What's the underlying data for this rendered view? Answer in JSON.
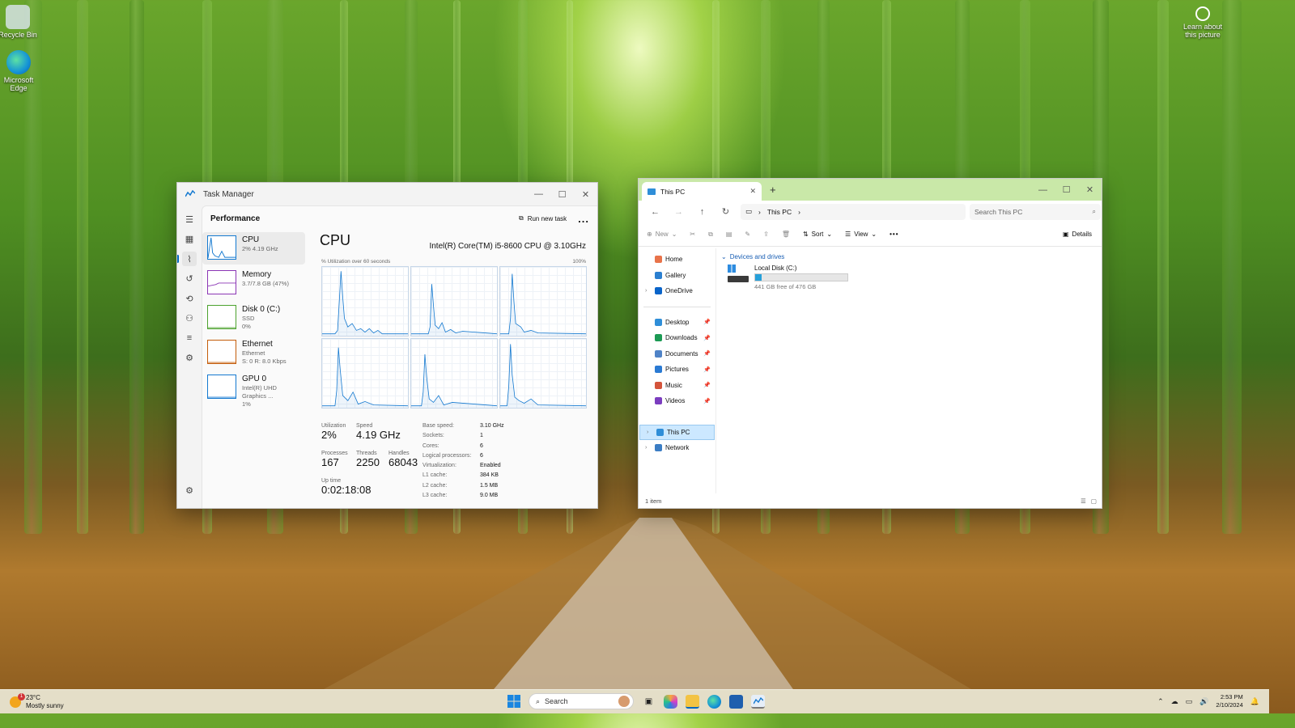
{
  "desktop": {
    "icons": [
      {
        "label": "Recycle Bin"
      },
      {
        "label": "Microsoft Edge"
      }
    ],
    "spotlight_label": "Learn about this picture"
  },
  "task_manager": {
    "title": "Task Manager",
    "page_title": "Performance",
    "run_new_task": "Run new task",
    "more": "...",
    "items": [
      {
        "name": "CPU",
        "sub1": "2%  4.19 GHz",
        "sub2": "",
        "sub3": "",
        "spark_color": "#1479d0"
      },
      {
        "name": "Memory",
        "sub1": "3.7/7.8 GB (47%)",
        "sub2": "",
        "sub3": "",
        "spark_color": "#8b36b5"
      },
      {
        "name": "Disk 0 (C:)",
        "sub1": "SSD",
        "sub2": "0%",
        "sub3": "",
        "spark_color": "#4ca22e"
      },
      {
        "name": "Ethernet",
        "sub1": "Ethernet",
        "sub2": "S: 0  R: 8.0 Kbps",
        "sub3": "",
        "spark_color": "#c45c0a"
      },
      {
        "name": "GPU 0",
        "sub1": "Intel(R) UHD Graphics ...",
        "sub2": "1%",
        "sub3": "",
        "spark_color": "#1479d0"
      }
    ],
    "cpu_title": "CPU",
    "cpu_model": "Intel(R) Core(TM) i5-8600 CPU @ 3.10GHz",
    "util_label": "% Utilization over 60 seconds",
    "util_max": "100%",
    "stats": {
      "utilization_label": "Utilization",
      "utilization": "2%",
      "speed_label": "Speed",
      "speed": "4.19 GHz",
      "processes_label": "Processes",
      "processes": "167",
      "threads_label": "Threads",
      "threads": "2250",
      "handles_label": "Handles",
      "handles": "68043",
      "uptime_label": "Up time",
      "uptime": "0:02:18:08"
    },
    "specs": [
      {
        "k": "Base speed:",
        "v": "3.10 GHz"
      },
      {
        "k": "Sockets:",
        "v": "1"
      },
      {
        "k": "Cores:",
        "v": "6"
      },
      {
        "k": "Logical processors:",
        "v": "6"
      },
      {
        "k": "Virtualization:",
        "v": "Enabled"
      },
      {
        "k": "L1 cache:",
        "v": "384 KB"
      },
      {
        "k": "L2 cache:",
        "v": "1.5 MB"
      },
      {
        "k": "L3 cache:",
        "v": "9.0 MB"
      }
    ]
  },
  "explorer": {
    "tab_title": "This PC",
    "breadcrumb": "This PC",
    "search_placeholder": "Search This PC",
    "cmd": {
      "new": "New",
      "sort": "Sort",
      "view": "View",
      "details": "Details"
    },
    "nav": [
      {
        "label": "Home",
        "color": "#e8734a",
        "chev": "",
        "pin": false
      },
      {
        "label": "Gallery",
        "color": "#2b7fd0",
        "chev": "",
        "pin": false
      },
      {
        "label": "OneDrive",
        "color": "#0a64c9",
        "chev": "›",
        "pin": false
      }
    ],
    "quick": [
      {
        "label": "Desktop",
        "color": "#2f8ed8"
      },
      {
        "label": "Downloads",
        "color": "#1c9a54"
      },
      {
        "label": "Documents",
        "color": "#4f83c7"
      },
      {
        "label": "Pictures",
        "color": "#2a7ad3"
      },
      {
        "label": "Music",
        "color": "#d4543b"
      },
      {
        "label": "Videos",
        "color": "#7b3dbf"
      }
    ],
    "this_pc": "This PC",
    "network": "Network",
    "group": "Devices and drives",
    "drive_name": "Local Disk (C:)",
    "drive_free": "441 GB free of 476 GB",
    "drive_used_fraction": 0.074,
    "status": "1 item"
  },
  "taskbar": {
    "temp": "23°C",
    "weather": "Mostly sunny",
    "weather_badge": "1",
    "search": "Search",
    "time": "2:53 PM",
    "date": "2/10/2024"
  }
}
